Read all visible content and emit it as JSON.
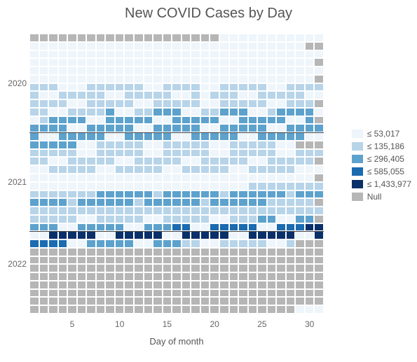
{
  "title": "New COVID Cases by Day",
  "xlabel": "Day of month",
  "years": [
    "2020",
    "2021",
    "2022"
  ],
  "xticks": [
    5,
    10,
    15,
    20,
    25,
    30
  ],
  "legend": [
    {
      "label": "≤ 53,017",
      "color": "#eef5fb"
    },
    {
      "label": "≤ 135,186",
      "color": "#b7d4e9"
    },
    {
      "label": "≤ 296,405",
      "color": "#5da2cd"
    },
    {
      "label": "≤ 585,055",
      "color": "#1b6bb1"
    },
    {
      "label": "≤ 1,433,977",
      "color": "#0a3069"
    },
    {
      "label": "Null",
      "color": "#b6b6b6"
    }
  ],
  "chart_data": {
    "type": "heatmap",
    "title": "New COVID Cases by Day",
    "xlabel": "Day of month",
    "ylabel": "",
    "xlim": [
      1,
      31
    ],
    "x": [
      1,
      2,
      3,
      4,
      5,
      6,
      7,
      8,
      9,
      10,
      11,
      12,
      13,
      14,
      15,
      16,
      17,
      18,
      19,
      20,
      21,
      22,
      23,
      24,
      25,
      26,
      27,
      28,
      29,
      30,
      31
    ],
    "y_labels": [
      "2020-01",
      "2020-02",
      "2020-03",
      "2020-04",
      "2020-05",
      "2020-06",
      "2020-07",
      "2020-08",
      "2020-09",
      "2020-10",
      "2020-11",
      "2020-12",
      "2021-01",
      "2021-02",
      "2021-03",
      "2021-04",
      "2021-05",
      "2021-06",
      "2021-07",
      "2021-08",
      "2021-09",
      "2021-10",
      "2021-11",
      "2021-12",
      "2022-01",
      "2022-02",
      "2022-03",
      "2022-04",
      "2022-05",
      "2022-06",
      "2022-07",
      "2022-08",
      "2022-09",
      "2022-10"
    ],
    "year_breaks": [
      0,
      12,
      24
    ],
    "bins": [
      53017,
      135186,
      296405,
      585055,
      1433977
    ],
    "values": [
      [
        null,
        null,
        null,
        null,
        null,
        null,
        null,
        null,
        null,
        null,
        null,
        null,
        null,
        null,
        null,
        null,
        null,
        null,
        null,
        null,
        0,
        0,
        0,
        0,
        0,
        0,
        0,
        0,
        0,
        0,
        0
      ],
      [
        0,
        0,
        0,
        0,
        0,
        0,
        0,
        0,
        0,
        0,
        0,
        0,
        0,
        0,
        0,
        0,
        0,
        0,
        0,
        0,
        0,
        0,
        0,
        0,
        0,
        0,
        0,
        0,
        0,
        null,
        null
      ],
      [
        0,
        0,
        0,
        0,
        0,
        0,
        0,
        0,
        0,
        0,
        0,
        0,
        0,
        0,
        0,
        0,
        0,
        0,
        0,
        0,
        0,
        0,
        0,
        0,
        0,
        0,
        0,
        0,
        0,
        0,
        0
      ],
      [
        0,
        0,
        0,
        0,
        0,
        0,
        0,
        0,
        0,
        0,
        0,
        0,
        0,
        0,
        0,
        0,
        0,
        0,
        0,
        0,
        0,
        0,
        0,
        0,
        0,
        0,
        0,
        0,
        0,
        0,
        null
      ],
      [
        0,
        0,
        0,
        0,
        0,
        0,
        0,
        0,
        0,
        0,
        0,
        0,
        0,
        0,
        0,
        0,
        0,
        0,
        0,
        0,
        0,
        0,
        0,
        0,
        0,
        0,
        0,
        0,
        0,
        0,
        0
      ],
      [
        0,
        0,
        0,
        0,
        0,
        0,
        0,
        0,
        0,
        0,
        0,
        0,
        0,
        0,
        0,
        0,
        0,
        0,
        0,
        0,
        0,
        0,
        0,
        0,
        0,
        0,
        0,
        0,
        0,
        0,
        null
      ],
      [
        1,
        1,
        1,
        0,
        0,
        0,
        1,
        1,
        1,
        1,
        1,
        1,
        0,
        0,
        1,
        1,
        1,
        1,
        0,
        0,
        1,
        1,
        1,
        1,
        1,
        0,
        0,
        1,
        1,
        1,
        1
      ],
      [
        1,
        0,
        0,
        1,
        1,
        1,
        1,
        1,
        0,
        0,
        1,
        1,
        1,
        1,
        1,
        0,
        0,
        1,
        0,
        1,
        1,
        1,
        0,
        0,
        1,
        1,
        1,
        1,
        1,
        0,
        0
      ],
      [
        1,
        1,
        1,
        1,
        0,
        0,
        1,
        1,
        1,
        1,
        1,
        0,
        0,
        1,
        1,
        1,
        1,
        1,
        0,
        0,
        1,
        1,
        1,
        1,
        1,
        0,
        0,
        1,
        1,
        1,
        null
      ],
      [
        1,
        1,
        0,
        0,
        1,
        1,
        1,
        1,
        2,
        0,
        0,
        1,
        1,
        2,
        2,
        2,
        0,
        0,
        1,
        1,
        2,
        2,
        2,
        0,
        0,
        1,
        2,
        2,
        2,
        2,
        0
      ],
      [
        0,
        1,
        2,
        2,
        2,
        2,
        0,
        0,
        2,
        2,
        2,
        2,
        2,
        0,
        0,
        2,
        2,
        2,
        2,
        2,
        0,
        0,
        2,
        2,
        2,
        2,
        2,
        0,
        0,
        2,
        null
      ],
      [
        2,
        2,
        2,
        2,
        0,
        0,
        2,
        2,
        2,
        2,
        2,
        0,
        0,
        2,
        2,
        2,
        2,
        2,
        0,
        0,
        2,
        2,
        2,
        2,
        2,
        0,
        0,
        2,
        2,
        2,
        2
      ],
      [
        2,
        0,
        0,
        2,
        2,
        2,
        2,
        2,
        0,
        0,
        2,
        2,
        2,
        2,
        2,
        0,
        0,
        2,
        2,
        2,
        2,
        2,
        0,
        0,
        2,
        2,
        2,
        2,
        2,
        0,
        0
      ],
      [
        2,
        2,
        2,
        2,
        2,
        0,
        0,
        1,
        1,
        1,
        1,
        1,
        0,
        0,
        1,
        1,
        1,
        1,
        1,
        0,
        0,
        1,
        1,
        1,
        1,
        1,
        0,
        0,
        null,
        null,
        null
      ],
      [
        1,
        1,
        1,
        1,
        1,
        0,
        0,
        1,
        1,
        1,
        1,
        1,
        0,
        0,
        1,
        1,
        1,
        1,
        1,
        0,
        0,
        1,
        1,
        1,
        1,
        1,
        0,
        0,
        1,
        1,
        1
      ],
      [
        1,
        1,
        0,
        0,
        1,
        1,
        1,
        1,
        1,
        0,
        0,
        1,
        1,
        1,
        1,
        1,
        0,
        0,
        1,
        1,
        1,
        1,
        1,
        0,
        0,
        1,
        1,
        1,
        1,
        1,
        null
      ],
      [
        0,
        0,
        1,
        1,
        1,
        1,
        1,
        0,
        0,
        1,
        1,
        1,
        1,
        1,
        0,
        0,
        1,
        1,
        1,
        1,
        1,
        0,
        0,
        1,
        1,
        1,
        1,
        1,
        0,
        0,
        0
      ],
      [
        0,
        0,
        0,
        0,
        0,
        0,
        0,
        0,
        0,
        0,
        0,
        0,
        0,
        0,
        0,
        0,
        0,
        0,
        0,
        0,
        0,
        0,
        0,
        0,
        0,
        0,
        0,
        0,
        0,
        0,
        null
      ],
      [
        0,
        0,
        0,
        0,
        0,
        0,
        0,
        0,
        0,
        0,
        0,
        0,
        0,
        0,
        0,
        0,
        0,
        0,
        0,
        0,
        0,
        0,
        0,
        1,
        1,
        1,
        1,
        1,
        1,
        1,
        1
      ],
      [
        1,
        1,
        1,
        1,
        1,
        1,
        1,
        2,
        2,
        2,
        2,
        2,
        2,
        1,
        2,
        2,
        2,
        2,
        2,
        2,
        1,
        2,
        2,
        2,
        2,
        2,
        2,
        1,
        2,
        2,
        2
      ],
      [
        2,
        2,
        2,
        2,
        1,
        2,
        2,
        2,
        2,
        2,
        2,
        1,
        2,
        2,
        2,
        2,
        2,
        2,
        1,
        2,
        2,
        2,
        2,
        2,
        2,
        1,
        1,
        1,
        1,
        1,
        null
      ],
      [
        1,
        1,
        1,
        1,
        1,
        1,
        1,
        1,
        1,
        1,
        1,
        1,
        1,
        1,
        1,
        1,
        1,
        1,
        1,
        1,
        1,
        1,
        1,
        1,
        1,
        1,
        1,
        1,
        1,
        1,
        1
      ],
      [
        1,
        1,
        1,
        1,
        1,
        0,
        0,
        1,
        1,
        1,
        1,
        1,
        0,
        0,
        1,
        1,
        1,
        1,
        1,
        0,
        0,
        1,
        1,
        1,
        2,
        2,
        0,
        0,
        2,
        2,
        null
      ],
      [
        2,
        2,
        2,
        0,
        0,
        2,
        2,
        2,
        2,
        2,
        0,
        0,
        2,
        2,
        2,
        3,
        3,
        0,
        0,
        3,
        3,
        3,
        3,
        3,
        0,
        0,
        3,
        3,
        3,
        4,
        4
      ],
      [
        0,
        0,
        4,
        4,
        4,
        4,
        4,
        0,
        0,
        4,
        4,
        4,
        4,
        4,
        0,
        0,
        4,
        4,
        4,
        4,
        4,
        0,
        0,
        4,
        4,
        4,
        4,
        4,
        0,
        0,
        4
      ],
      [
        3,
        3,
        3,
        3,
        0,
        0,
        2,
        2,
        2,
        2,
        2,
        0,
        0,
        2,
        2,
        2,
        1,
        1,
        0,
        0,
        1,
        1,
        1,
        1,
        1,
        0,
        0,
        1,
        null,
        null,
        null
      ],
      [
        null,
        null,
        null,
        null,
        null,
        null,
        null,
        null,
        null,
        null,
        null,
        null,
        null,
        null,
        null,
        null,
        null,
        null,
        null,
        null,
        null,
        null,
        null,
        null,
        null,
        null,
        null,
        null,
        null,
        null,
        null
      ],
      [
        null,
        null,
        null,
        null,
        null,
        null,
        null,
        null,
        null,
        null,
        null,
        null,
        null,
        null,
        null,
        null,
        null,
        null,
        null,
        null,
        null,
        null,
        null,
        null,
        null,
        null,
        null,
        null,
        null,
        null,
        null
      ],
      [
        null,
        null,
        null,
        null,
        null,
        null,
        null,
        null,
        null,
        null,
        null,
        null,
        null,
        null,
        null,
        null,
        null,
        null,
        null,
        null,
        null,
        null,
        null,
        null,
        null,
        null,
        null,
        null,
        null,
        null,
        null
      ],
      [
        null,
        null,
        null,
        null,
        null,
        null,
        null,
        null,
        null,
        null,
        null,
        null,
        null,
        null,
        null,
        null,
        null,
        null,
        null,
        null,
        null,
        null,
        null,
        null,
        null,
        null,
        null,
        null,
        null,
        null,
        null
      ],
      [
        null,
        null,
        null,
        null,
        null,
        null,
        null,
        null,
        null,
        null,
        null,
        null,
        null,
        null,
        null,
        null,
        null,
        null,
        null,
        null,
        null,
        null,
        null,
        null,
        null,
        null,
        null,
        null,
        null,
        null,
        null
      ],
      [
        null,
        null,
        null,
        null,
        null,
        null,
        null,
        null,
        null,
        null,
        null,
        null,
        null,
        null,
        null,
        null,
        null,
        null,
        null,
        null,
        null,
        null,
        null,
        null,
        null,
        null,
        null,
        null,
        null,
        null,
        null
      ],
      [
        null,
        null,
        null,
        null,
        null,
        null,
        null,
        null,
        null,
        null,
        null,
        null,
        null,
        null,
        null,
        null,
        null,
        null,
        null,
        null,
        null,
        null,
        null,
        null,
        null,
        null,
        null,
        null,
        null,
        null,
        null
      ],
      [
        null,
        null,
        null,
        null,
        null,
        null,
        null,
        null,
        null,
        null,
        null,
        null,
        null,
        null,
        null,
        null,
        null,
        null,
        null,
        null,
        null,
        null,
        null,
        null,
        null,
        null,
        null,
        null,
        0,
        0,
        0
      ]
    ]
  }
}
